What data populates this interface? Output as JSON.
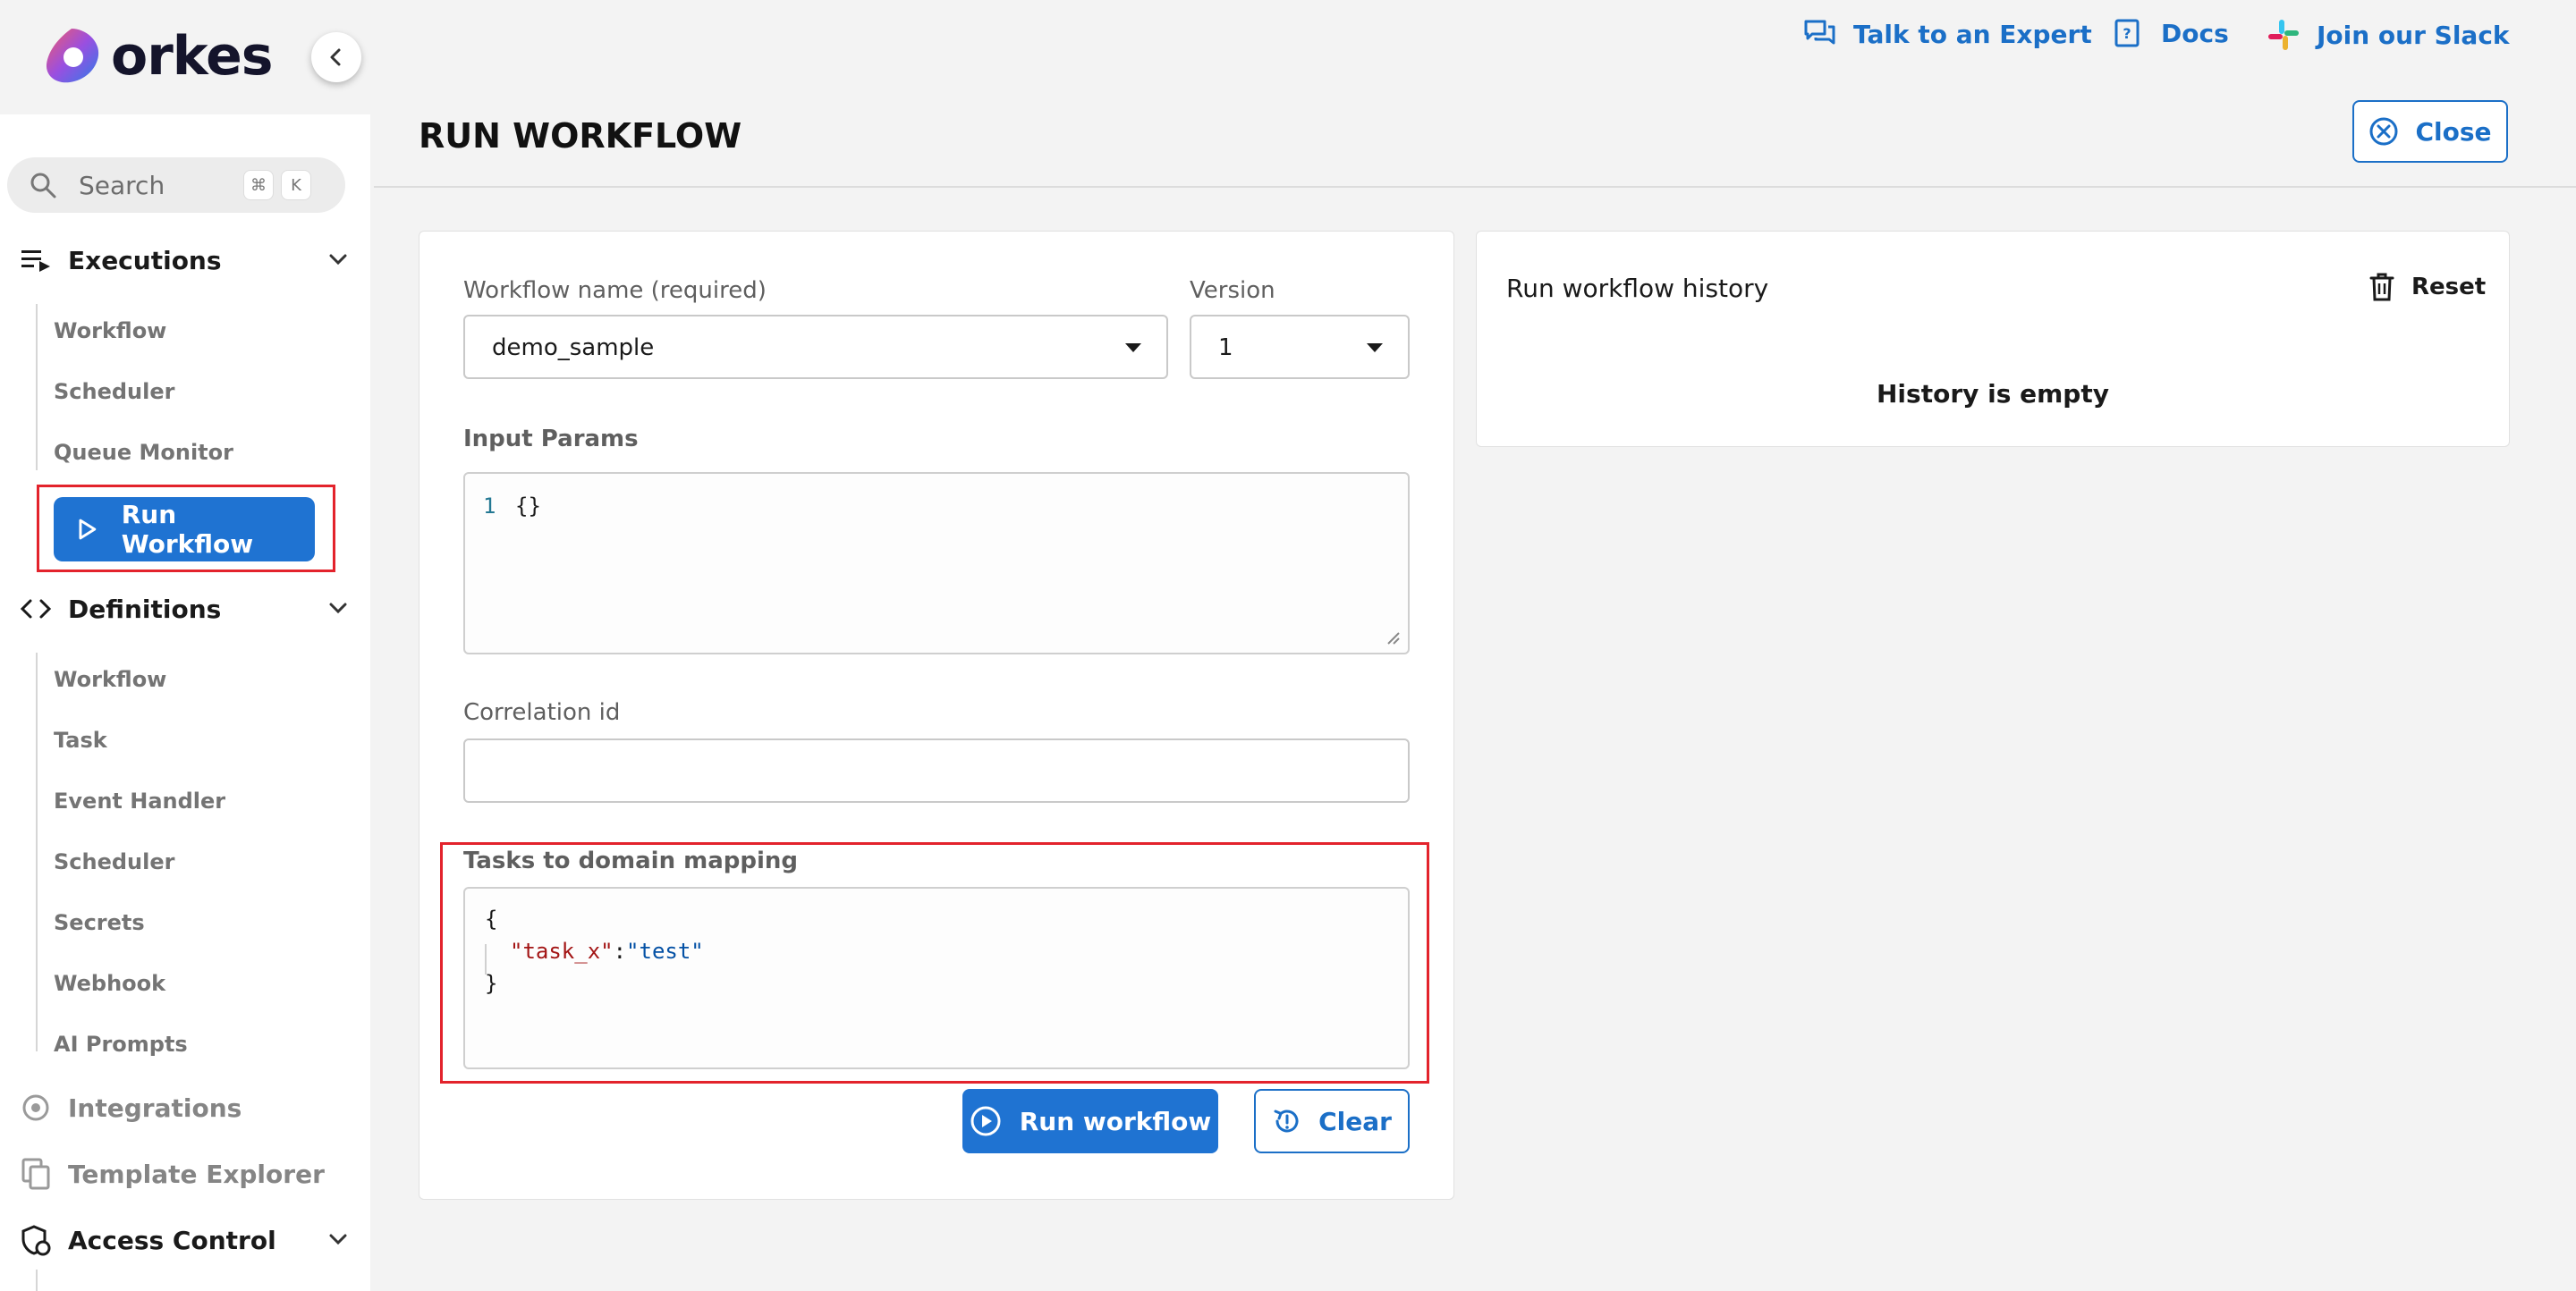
{
  "brand": {
    "name": "orkes"
  },
  "header": {
    "links": [
      {
        "label": "Talk to an Expert",
        "icon": "chat-icon"
      },
      {
        "label": "Docs",
        "icon": "book-icon"
      },
      {
        "label": "Join our Slack",
        "icon": "slack-icon"
      }
    ],
    "title": "RUN WORKFLOW",
    "close_label": "Close"
  },
  "sidebar": {
    "search": {
      "placeholder": "Search",
      "kbd_cmd": "⌘",
      "kbd_key": "K"
    },
    "executions": {
      "label": "Executions",
      "items": [
        "Workflow",
        "Scheduler",
        "Queue Monitor"
      ],
      "run_workflow": "Run Workflow"
    },
    "definitions": {
      "label": "Definitions",
      "items": [
        "Workflow",
        "Task",
        "Event Handler",
        "Scheduler",
        "Secrets",
        "Webhook",
        "AI Prompts"
      ]
    },
    "integrations": "Integrations",
    "template_explorer": "Template Explorer",
    "access_control": "Access Control"
  },
  "form": {
    "workflow_name_label": "Workflow name (required)",
    "workflow_name_value": "demo_sample",
    "version_label": "Version",
    "version_value": "1",
    "input_params_label": "Input Params",
    "input_params_line_no": "1",
    "input_params_code": "{}",
    "correlation_label": "Correlation id",
    "correlation_value": "",
    "domain_mapping_label": "Tasks to domain mapping",
    "domain_mapping_code": {
      "open": "{",
      "key": "\"task_x\"",
      "colon": ":",
      "value": "\"test\"",
      "close": "}"
    },
    "run_button": "Run workflow",
    "clear_button": "Clear"
  },
  "history": {
    "title": "Run workflow history",
    "reset_label": "Reset",
    "empty_text": "History is empty"
  },
  "colors": {
    "accent": "#1f73d2",
    "link": "#1b6fc7",
    "highlight": "#e3232c",
    "json_key": "#a31515",
    "json_string": "#0451a5"
  }
}
